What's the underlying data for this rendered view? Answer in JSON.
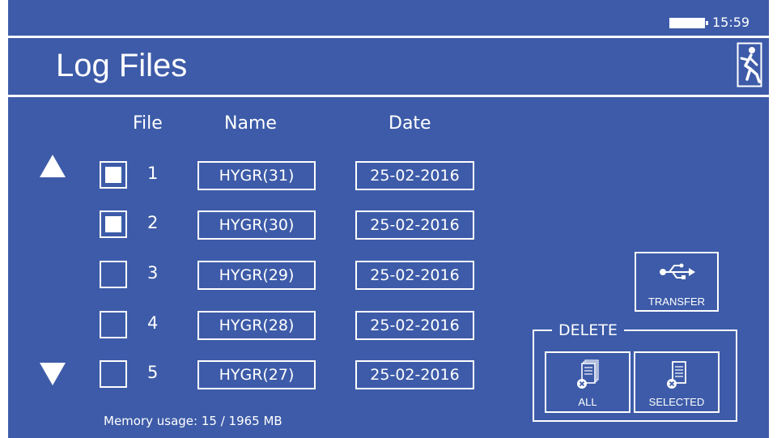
{
  "status": {
    "time": "15:59",
    "battery_icon": "battery-icon"
  },
  "header": {
    "title": "Log Files",
    "exit_icon": "exit-icon"
  },
  "table": {
    "columns": [
      "File",
      "Name",
      "Date"
    ],
    "rows": [
      {
        "file": "1",
        "name": "HYGR(31)",
        "date": "25-02-2016",
        "selected": true
      },
      {
        "file": "2",
        "name": "HYGR(30)",
        "date": "25-02-2016",
        "selected": true
      },
      {
        "file": "3",
        "name": "HYGR(29)",
        "date": "25-02-2016",
        "selected": false
      },
      {
        "file": "4",
        "name": "HYGR(28)",
        "date": "25-02-2016",
        "selected": false
      },
      {
        "file": "5",
        "name": "HYGR(27)",
        "date": "25-02-2016",
        "selected": false
      }
    ]
  },
  "scroll": {
    "up_icon": "triangle-up-icon",
    "down_icon": "triangle-down-icon"
  },
  "memory": {
    "text": "Memory usage: 15 / 1965 MB"
  },
  "actions": {
    "transfer_label": "TRANSFER",
    "transfer_icon": "usb-icon",
    "delete_group_label": "DELETE",
    "delete_all_label": "ALL",
    "delete_selected_label": "SELECTED",
    "delete_all_icon": "delete-all-files-icon",
    "delete_selected_icon": "delete-file-icon"
  },
  "colors": {
    "background": "#3d5ba8",
    "foreground": "#ffffff"
  }
}
